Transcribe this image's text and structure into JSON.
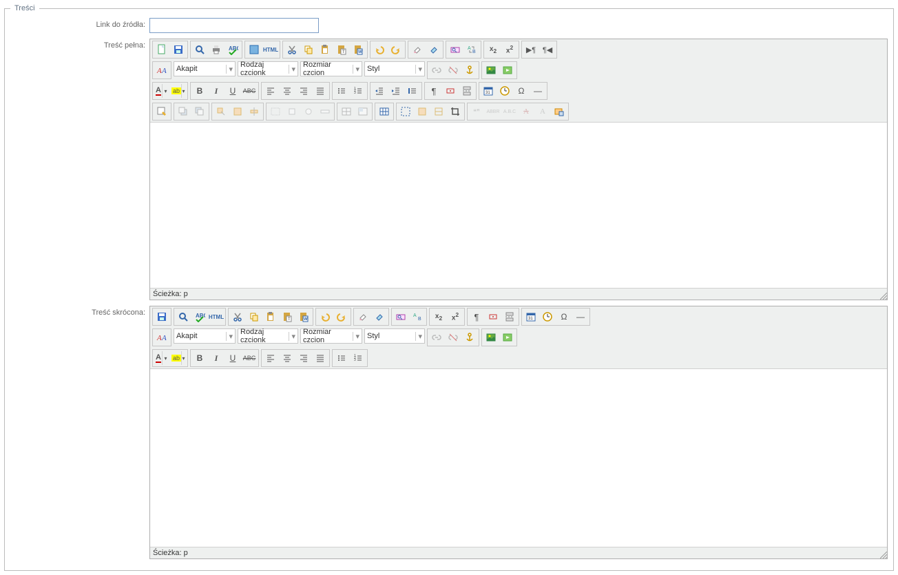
{
  "legend": "Treści",
  "labels": {
    "link": "Link do źródła:",
    "full": "Treść pełna:",
    "short": "Treść skrócona:"
  },
  "link_value": "",
  "dropdowns": {
    "paragraph": "Akapit",
    "font_family": "Rodzaj czcionk",
    "font_size": "Rozmiar czcion",
    "style": "Styl"
  },
  "path_label": "Ścieżka:",
  "path_value": "p",
  "tb": {
    "new": "",
    "save": "",
    "preview": "",
    "print": "",
    "spell": "",
    "full": "",
    "html": "HTML",
    "cut": "",
    "copy": "",
    "paste": "",
    "paste_text": "",
    "paste_word": "",
    "undo": "",
    "redo": "",
    "erase": "",
    "clean": "",
    "find": "",
    "replace": "",
    "sub": "x₂",
    "sup": "x²",
    "ltr": "",
    "rtl": "",
    "font_color": "",
    "bg": "",
    "bold": "B",
    "italic": "I",
    "under": "U",
    "strike": "ABC",
    "left": "",
    "center": "",
    "right": "",
    "justify": "",
    "ul": "",
    "ol": "",
    "outdent": "",
    "indent": "",
    "para": "¶",
    "br": "",
    "hr": "—",
    "date": "",
    "time": "",
    "omega": "Ω",
    "link_i": "",
    "unlink": "",
    "anchor": "",
    "img": "",
    "media": ""
  }
}
